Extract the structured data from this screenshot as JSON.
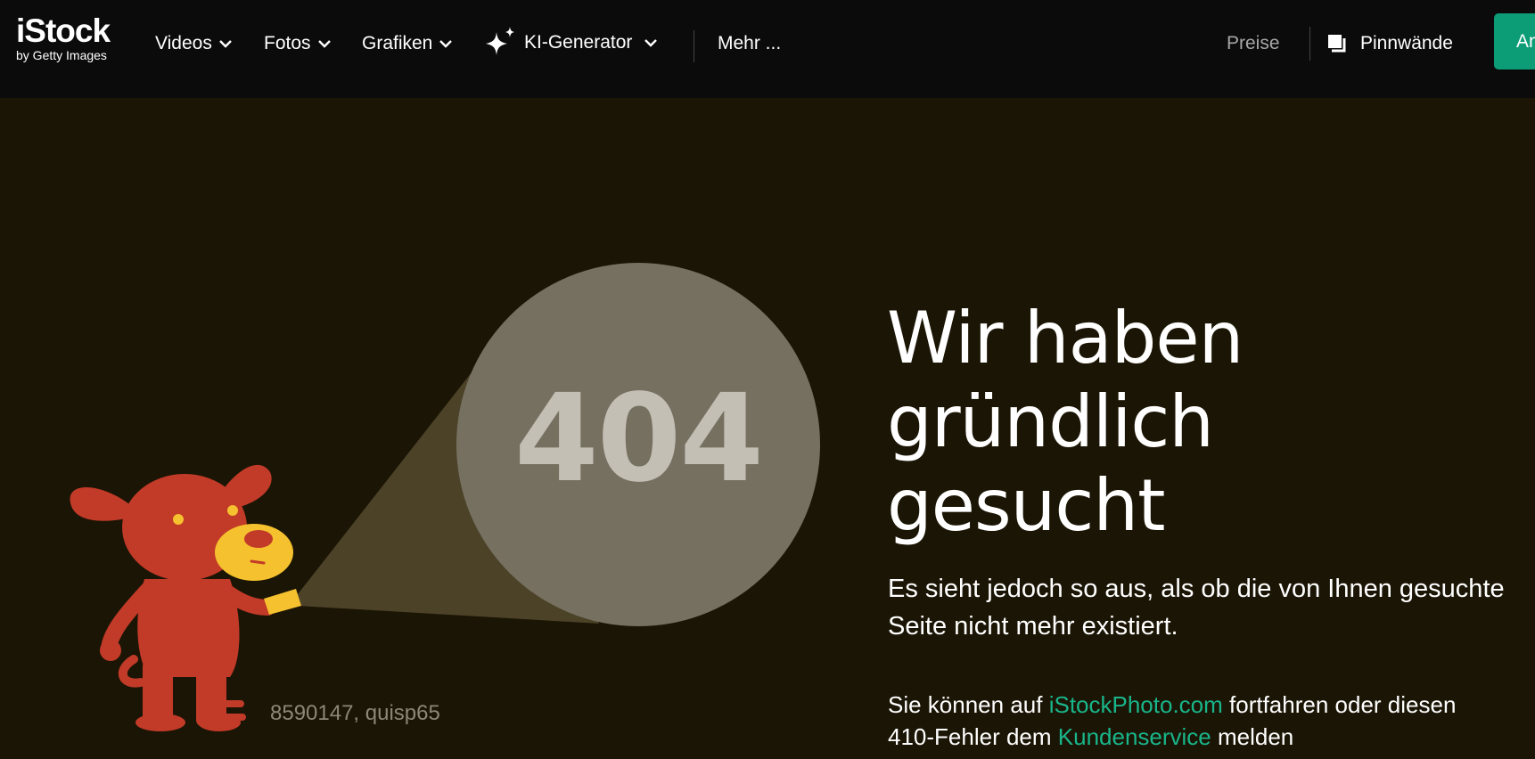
{
  "header": {
    "logo": {
      "title": "iStock",
      "subtitle": "by Getty Images"
    },
    "nav": [
      {
        "label": "Videos",
        "icon": "chevron-down-icon"
      },
      {
        "label": "Fotos",
        "icon": "chevron-down-icon"
      },
      {
        "label": "Grafiken",
        "icon": "chevron-down-icon"
      },
      {
        "label": "KI-Generator",
        "icon": "sparkle-icon"
      },
      {
        "label": "Mehr ..."
      }
    ],
    "right": {
      "pricing_label": "Preise",
      "boards_label": "Pinnwände",
      "boards_icon": "boards-icon",
      "signup_label": "Anmelden"
    }
  },
  "main": {
    "error_code": "404",
    "image_credit": "8590147, quisp65",
    "headline_lines": [
      "Wir haben",
      "gründlich",
      "gesucht"
    ],
    "subtext": "Es sieht jedoch so aus, als ob die von Ihnen gesuchte Seite nicht mehr existiert.",
    "note": {
      "part1": "Sie können auf ",
      "link1": "iStockPhoto.com",
      "part2": " fortfahren oder diesen",
      "part3": "410-Fehler dem ",
      "link2": "Kundenservice",
      "part4": " melden"
    }
  },
  "colors": {
    "nav_bg": "#0b0b0b",
    "page_bg": "#1b1505",
    "accent": "#0c9d77",
    "link": "#19b58a",
    "dog": "#c23a28",
    "spot": "#f5c12e"
  }
}
